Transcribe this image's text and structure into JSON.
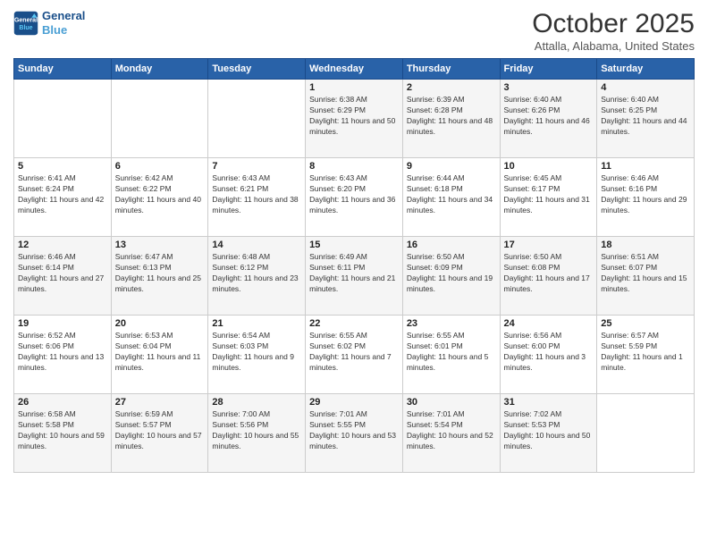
{
  "logo": {
    "line1": "General",
    "line2": "Blue"
  },
  "title": "October 2025",
  "location": "Attalla, Alabama, United States",
  "weekdays": [
    "Sunday",
    "Monday",
    "Tuesday",
    "Wednesday",
    "Thursday",
    "Friday",
    "Saturday"
  ],
  "weeks": [
    [
      {
        "day": "",
        "sunrise": "",
        "sunset": "",
        "daylight": ""
      },
      {
        "day": "",
        "sunrise": "",
        "sunset": "",
        "daylight": ""
      },
      {
        "day": "",
        "sunrise": "",
        "sunset": "",
        "daylight": ""
      },
      {
        "day": "1",
        "sunrise": "Sunrise: 6:38 AM",
        "sunset": "Sunset: 6:29 PM",
        "daylight": "Daylight: 11 hours and 50 minutes."
      },
      {
        "day": "2",
        "sunrise": "Sunrise: 6:39 AM",
        "sunset": "Sunset: 6:28 PM",
        "daylight": "Daylight: 11 hours and 48 minutes."
      },
      {
        "day": "3",
        "sunrise": "Sunrise: 6:40 AM",
        "sunset": "Sunset: 6:26 PM",
        "daylight": "Daylight: 11 hours and 46 minutes."
      },
      {
        "day": "4",
        "sunrise": "Sunrise: 6:40 AM",
        "sunset": "Sunset: 6:25 PM",
        "daylight": "Daylight: 11 hours and 44 minutes."
      }
    ],
    [
      {
        "day": "5",
        "sunrise": "Sunrise: 6:41 AM",
        "sunset": "Sunset: 6:24 PM",
        "daylight": "Daylight: 11 hours and 42 minutes."
      },
      {
        "day": "6",
        "sunrise": "Sunrise: 6:42 AM",
        "sunset": "Sunset: 6:22 PM",
        "daylight": "Daylight: 11 hours and 40 minutes."
      },
      {
        "day": "7",
        "sunrise": "Sunrise: 6:43 AM",
        "sunset": "Sunset: 6:21 PM",
        "daylight": "Daylight: 11 hours and 38 minutes."
      },
      {
        "day": "8",
        "sunrise": "Sunrise: 6:43 AM",
        "sunset": "Sunset: 6:20 PM",
        "daylight": "Daylight: 11 hours and 36 minutes."
      },
      {
        "day": "9",
        "sunrise": "Sunrise: 6:44 AM",
        "sunset": "Sunset: 6:18 PM",
        "daylight": "Daylight: 11 hours and 34 minutes."
      },
      {
        "day": "10",
        "sunrise": "Sunrise: 6:45 AM",
        "sunset": "Sunset: 6:17 PM",
        "daylight": "Daylight: 11 hours and 31 minutes."
      },
      {
        "day": "11",
        "sunrise": "Sunrise: 6:46 AM",
        "sunset": "Sunset: 6:16 PM",
        "daylight": "Daylight: 11 hours and 29 minutes."
      }
    ],
    [
      {
        "day": "12",
        "sunrise": "Sunrise: 6:46 AM",
        "sunset": "Sunset: 6:14 PM",
        "daylight": "Daylight: 11 hours and 27 minutes."
      },
      {
        "day": "13",
        "sunrise": "Sunrise: 6:47 AM",
        "sunset": "Sunset: 6:13 PM",
        "daylight": "Daylight: 11 hours and 25 minutes."
      },
      {
        "day": "14",
        "sunrise": "Sunrise: 6:48 AM",
        "sunset": "Sunset: 6:12 PM",
        "daylight": "Daylight: 11 hours and 23 minutes."
      },
      {
        "day": "15",
        "sunrise": "Sunrise: 6:49 AM",
        "sunset": "Sunset: 6:11 PM",
        "daylight": "Daylight: 11 hours and 21 minutes."
      },
      {
        "day": "16",
        "sunrise": "Sunrise: 6:50 AM",
        "sunset": "Sunset: 6:09 PM",
        "daylight": "Daylight: 11 hours and 19 minutes."
      },
      {
        "day": "17",
        "sunrise": "Sunrise: 6:50 AM",
        "sunset": "Sunset: 6:08 PM",
        "daylight": "Daylight: 11 hours and 17 minutes."
      },
      {
        "day": "18",
        "sunrise": "Sunrise: 6:51 AM",
        "sunset": "Sunset: 6:07 PM",
        "daylight": "Daylight: 11 hours and 15 minutes."
      }
    ],
    [
      {
        "day": "19",
        "sunrise": "Sunrise: 6:52 AM",
        "sunset": "Sunset: 6:06 PM",
        "daylight": "Daylight: 11 hours and 13 minutes."
      },
      {
        "day": "20",
        "sunrise": "Sunrise: 6:53 AM",
        "sunset": "Sunset: 6:04 PM",
        "daylight": "Daylight: 11 hours and 11 minutes."
      },
      {
        "day": "21",
        "sunrise": "Sunrise: 6:54 AM",
        "sunset": "Sunset: 6:03 PM",
        "daylight": "Daylight: 11 hours and 9 minutes."
      },
      {
        "day": "22",
        "sunrise": "Sunrise: 6:55 AM",
        "sunset": "Sunset: 6:02 PM",
        "daylight": "Daylight: 11 hours and 7 minutes."
      },
      {
        "day": "23",
        "sunrise": "Sunrise: 6:55 AM",
        "sunset": "Sunset: 6:01 PM",
        "daylight": "Daylight: 11 hours and 5 minutes."
      },
      {
        "day": "24",
        "sunrise": "Sunrise: 6:56 AM",
        "sunset": "Sunset: 6:00 PM",
        "daylight": "Daylight: 11 hours and 3 minutes."
      },
      {
        "day": "25",
        "sunrise": "Sunrise: 6:57 AM",
        "sunset": "Sunset: 5:59 PM",
        "daylight": "Daylight: 11 hours and 1 minute."
      }
    ],
    [
      {
        "day": "26",
        "sunrise": "Sunrise: 6:58 AM",
        "sunset": "Sunset: 5:58 PM",
        "daylight": "Daylight: 10 hours and 59 minutes."
      },
      {
        "day": "27",
        "sunrise": "Sunrise: 6:59 AM",
        "sunset": "Sunset: 5:57 PM",
        "daylight": "Daylight: 10 hours and 57 minutes."
      },
      {
        "day": "28",
        "sunrise": "Sunrise: 7:00 AM",
        "sunset": "Sunset: 5:56 PM",
        "daylight": "Daylight: 10 hours and 55 minutes."
      },
      {
        "day": "29",
        "sunrise": "Sunrise: 7:01 AM",
        "sunset": "Sunset: 5:55 PM",
        "daylight": "Daylight: 10 hours and 53 minutes."
      },
      {
        "day": "30",
        "sunrise": "Sunrise: 7:01 AM",
        "sunset": "Sunset: 5:54 PM",
        "daylight": "Daylight: 10 hours and 52 minutes."
      },
      {
        "day": "31",
        "sunrise": "Sunrise: 7:02 AM",
        "sunset": "Sunset: 5:53 PM",
        "daylight": "Daylight: 10 hours and 50 minutes."
      },
      {
        "day": "",
        "sunrise": "",
        "sunset": "",
        "daylight": ""
      }
    ]
  ]
}
